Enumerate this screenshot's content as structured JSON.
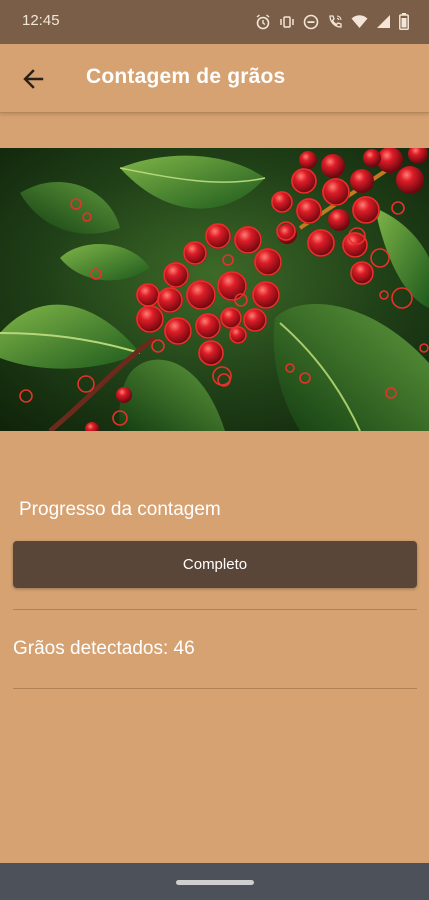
{
  "status_bar": {
    "time": "12:45",
    "icons": [
      "alarm-icon",
      "vibrate-icon",
      "do-not-disturb-icon",
      "wifi-call-icon",
      "wifi-icon",
      "signal-icon",
      "battery-icon"
    ]
  },
  "app_bar": {
    "title": "Contagem de grãos",
    "back_icon": "arrow-back-icon"
  },
  "photo": {
    "description_icon": "coffee-cherries-photo",
    "marker_color": "#e8312a"
  },
  "progress": {
    "label": "Progresso da contagem",
    "button_label": "Completo"
  },
  "result": {
    "label": "Grãos detectados: 46"
  },
  "colors": {
    "background": "#d6a272",
    "button": "#5a4638",
    "status_bar": "#7a5e47",
    "nav_bar": "#4d5159"
  }
}
